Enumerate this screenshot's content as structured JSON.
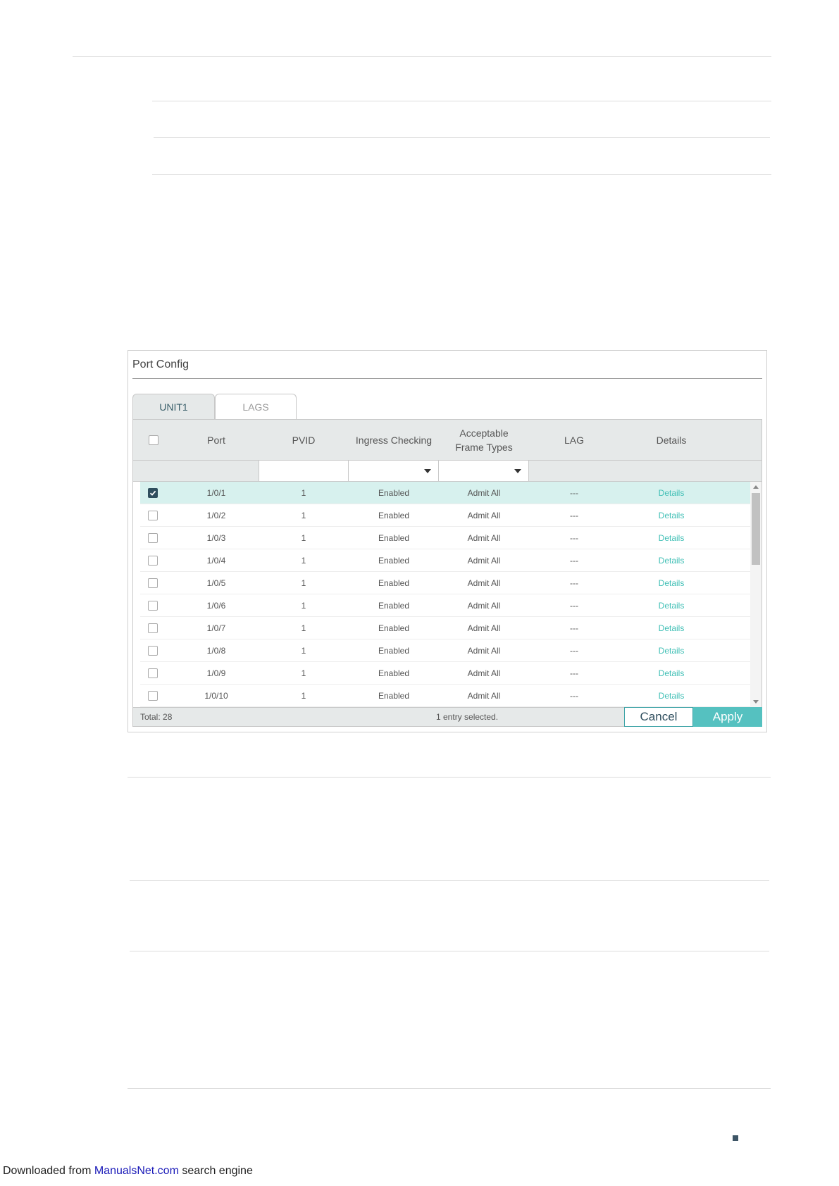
{
  "panel": {
    "title": "Port Config",
    "tabs": [
      {
        "label": "UNIT1",
        "active": true
      },
      {
        "label": "LAGS",
        "active": false
      }
    ],
    "columns": [
      "",
      "Port",
      "PVID",
      "Ingress Checking",
      "Acceptable Frame Types",
      "LAG",
      "Details"
    ],
    "rows": [
      {
        "checked": true,
        "port": "1/0/1",
        "pvid": "1",
        "ingress": "Enabled",
        "frame_types": "Admit All",
        "lag": "---",
        "details": "Details"
      },
      {
        "checked": false,
        "port": "1/0/2",
        "pvid": "1",
        "ingress": "Enabled",
        "frame_types": "Admit All",
        "lag": "---",
        "details": "Details"
      },
      {
        "checked": false,
        "port": "1/0/3",
        "pvid": "1",
        "ingress": "Enabled",
        "frame_types": "Admit All",
        "lag": "---",
        "details": "Details"
      },
      {
        "checked": false,
        "port": "1/0/4",
        "pvid": "1",
        "ingress": "Enabled",
        "frame_types": "Admit All",
        "lag": "---",
        "details": "Details"
      },
      {
        "checked": false,
        "port": "1/0/5",
        "pvid": "1",
        "ingress": "Enabled",
        "frame_types": "Admit All",
        "lag": "---",
        "details": "Details"
      },
      {
        "checked": false,
        "port": "1/0/6",
        "pvid": "1",
        "ingress": "Enabled",
        "frame_types": "Admit All",
        "lag": "---",
        "details": "Details"
      },
      {
        "checked": false,
        "port": "1/0/7",
        "pvid": "1",
        "ingress": "Enabled",
        "frame_types": "Admit All",
        "lag": "---",
        "details": "Details"
      },
      {
        "checked": false,
        "port": "1/0/8",
        "pvid": "1",
        "ingress": "Enabled",
        "frame_types": "Admit All",
        "lag": "---",
        "details": "Details"
      },
      {
        "checked": false,
        "port": "1/0/9",
        "pvid": "1",
        "ingress": "Enabled",
        "frame_types": "Admit All",
        "lag": "---",
        "details": "Details"
      },
      {
        "checked": false,
        "port": "1/0/10",
        "pvid": "1",
        "ingress": "Enabled",
        "frame_types": "Admit All",
        "lag": "---",
        "details": "Details"
      }
    ],
    "footer": {
      "total": "Total: 28",
      "selected": "1 entry selected.",
      "cancel_label": "Cancel",
      "apply_label": "Apply"
    }
  },
  "colors": {
    "accent": "#55c1c0",
    "selected_row": "#d7f1ee",
    "link": "#3fbfb5"
  },
  "footer_note": {
    "prefix": "Downloaded from ",
    "link": "ManualsNet.com",
    "suffix": " search engine"
  }
}
